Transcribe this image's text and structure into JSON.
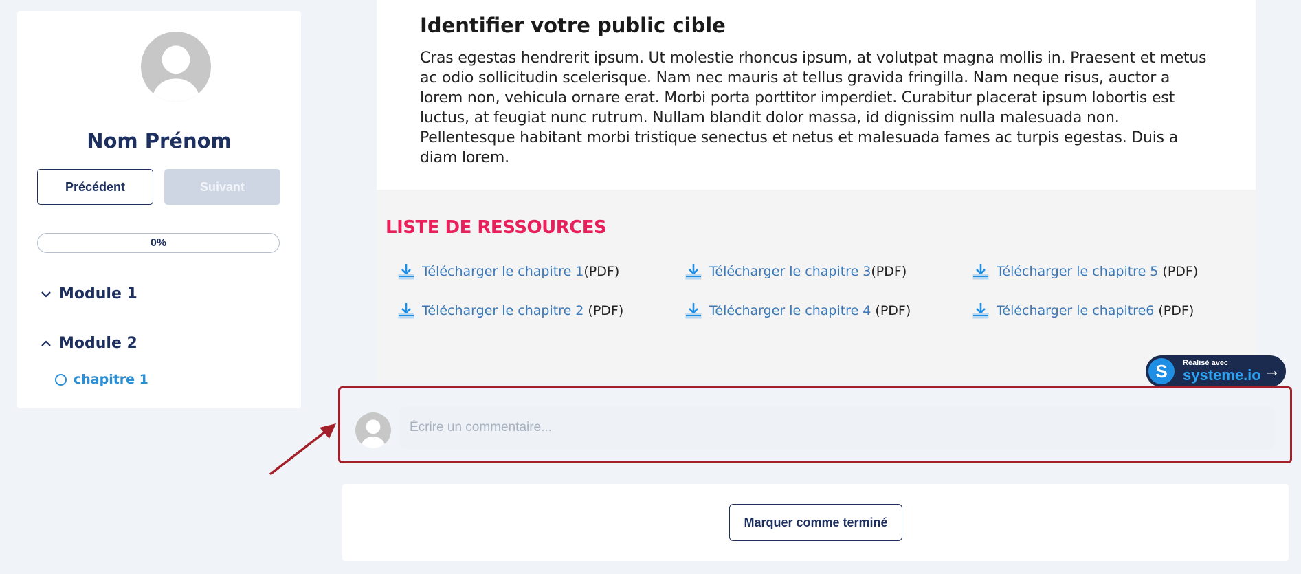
{
  "sidebar": {
    "profile_name": "Nom Prénom",
    "prev_label": "Précédent",
    "next_label": "Suivant",
    "progress_text": "0%",
    "progress_value": 0,
    "modules": [
      {
        "label": "Module 1",
        "expanded": false
      },
      {
        "label": "Module 2",
        "expanded": true
      }
    ],
    "chapter_label": "chapitre 1"
  },
  "content": {
    "title": "Identifier votre public cible",
    "body": "Cras egestas hendrerit ipsum. Ut molestie rhoncus ipsum, at volutpat magna mollis in. Praesent et metus ac odio sollicitudin scelerisque. Nam nec mauris at tellus gravida fringilla. Nam neque risus, auctor a lorem non, vehicula ornare erat. Morbi porta porttitor imperdiet. Curabitur placerat ipsum lobortis est luctus, at feugiat nunc rutrum. Nullam blandit dolor massa, id dignissim nulla malesuada non. Pellentesque habitant morbi tristique senectus et netus et malesuada fames ac turpis egestas. Duis a diam lorem."
  },
  "resources": {
    "title": "LISTE DE RESSOURCES",
    "items": [
      {
        "link": "Télécharger le chapitre 1",
        "suffix": "(PDF)"
      },
      {
        "link": "Télécharger le chapitre 3",
        "suffix": "(PDF)"
      },
      {
        "link": "Télécharger le chapitre 5",
        "suffix": " (PDF)"
      },
      {
        "link": "Télécharger le chapitre 2",
        "suffix": " (PDF)"
      },
      {
        "link": "Télécharger le chapitre 4",
        "suffix": " (PDF)"
      },
      {
        "link": "Télécharger le chapitre6",
        "suffix": " (PDF)"
      }
    ]
  },
  "badge": {
    "small_text": "Réalisé avec",
    "brand": "systeme.io",
    "icon": "arrow-right-icon"
  },
  "comment": {
    "placeholder": "Écrire un commentaire..."
  },
  "footer": {
    "finish_label": "Marquer comme terminé"
  },
  "colors": {
    "navy": "#1d2f5e",
    "accent_pink": "#e8205c",
    "link_blue": "#3a78b8",
    "highlight_red": "#a3202a"
  }
}
